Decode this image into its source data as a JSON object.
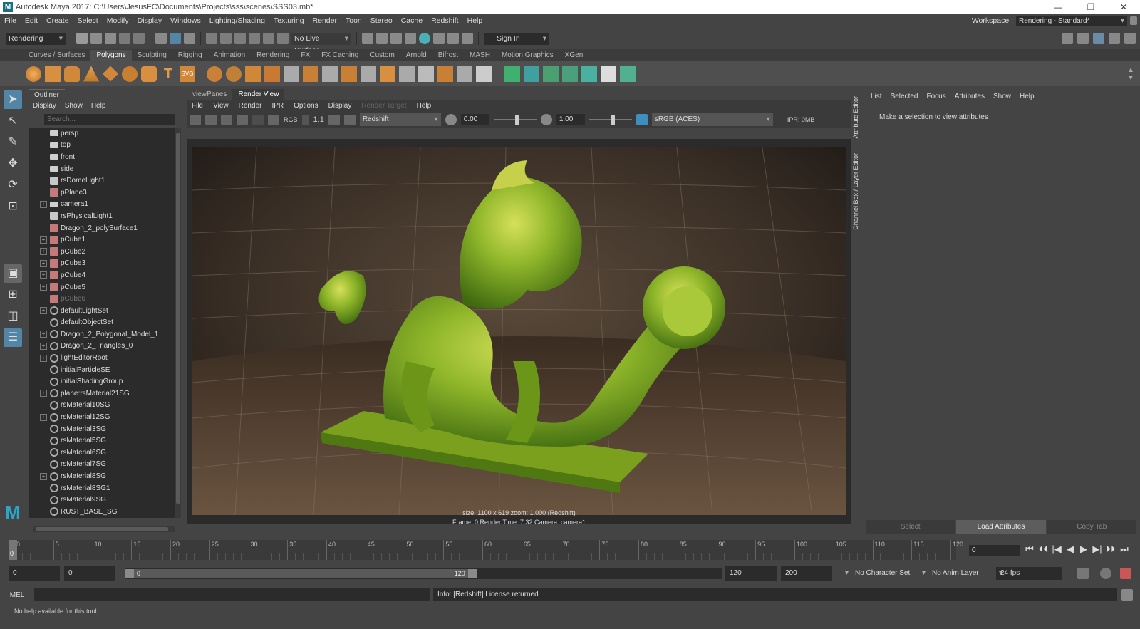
{
  "window": {
    "title": "Autodesk Maya 2017: C:\\Users\\JesusFC\\Documents\\Projects\\sss\\scenes\\SSS03.mb*",
    "app_icon": "M",
    "controls": [
      "—",
      "❐",
      "✕"
    ]
  },
  "menu": {
    "items": [
      "File",
      "Edit",
      "Create",
      "Select",
      "Modify",
      "Display",
      "Windows",
      "Lighting/Shading",
      "Texturing",
      "Render",
      "Toon",
      "Stereo",
      "Cache",
      "Redshift",
      "Help"
    ],
    "workspace_label": "Workspace :",
    "workspace_value": "Rendering - Standard*"
  },
  "statusline": {
    "menuset": "Rendering",
    "live_surface": "No Live Surface",
    "sign_in": "Sign In"
  },
  "shelf": {
    "tabs": [
      "Curves / Surfaces",
      "Polygons",
      "Sculpting",
      "Rigging",
      "Animation",
      "Rendering",
      "FX",
      "FX Caching",
      "Custom",
      "Arnold",
      "Bifrost",
      "MASH",
      "Motion Graphics",
      "XGen"
    ],
    "active_tab": "Polygons",
    "svg_label": "SVG",
    "text_label": "T"
  },
  "outliner": {
    "tab": "Outliner",
    "menu": [
      "Display",
      "Show",
      "Help"
    ],
    "search_placeholder": "Search...",
    "items": [
      {
        "name": "persp",
        "icon": "camera-icon",
        "expand": false,
        "dim": false
      },
      {
        "name": "top",
        "icon": "camera-icon",
        "expand": false,
        "dim": false
      },
      {
        "name": "front",
        "icon": "camera-icon",
        "expand": false,
        "dim": false
      },
      {
        "name": "side",
        "icon": "camera-icon",
        "expand": false,
        "dim": false
      },
      {
        "name": "rsDomeLight1",
        "icon": "light-icon",
        "expand": false,
        "dim": false
      },
      {
        "name": "pPlane3",
        "icon": "mesh-icon",
        "expand": false,
        "dim": false
      },
      {
        "name": "camera1",
        "icon": "camera-icon",
        "expand": true,
        "dim": false
      },
      {
        "name": "rsPhysicalLight1",
        "icon": "light-icon",
        "expand": false,
        "dim": false
      },
      {
        "name": "Dragon_2_polySurface1",
        "icon": "mesh-icon",
        "expand": false,
        "dim": false
      },
      {
        "name": "pCube1",
        "icon": "mesh-icon",
        "expand": true,
        "dim": false
      },
      {
        "name": "pCube2",
        "icon": "mesh-icon",
        "expand": true,
        "dim": false
      },
      {
        "name": "pCube3",
        "icon": "mesh-icon",
        "expand": true,
        "dim": false
      },
      {
        "name": "pCube4",
        "icon": "mesh-icon",
        "expand": true,
        "dim": false
      },
      {
        "name": "pCube5",
        "icon": "mesh-icon",
        "expand": true,
        "dim": false
      },
      {
        "name": "pCube6",
        "icon": "mesh-icon",
        "expand": false,
        "dim": true
      },
      {
        "name": "defaultLightSet",
        "icon": "set-icon",
        "expand": true,
        "dim": false
      },
      {
        "name": "defaultObjectSet",
        "icon": "set-icon",
        "expand": false,
        "dim": false
      },
      {
        "name": "Dragon_2_Polygonal_Model_1",
        "icon": "set-icon",
        "expand": true,
        "dim": false
      },
      {
        "name": "Dragon_2_Triangles_0",
        "icon": "set-icon",
        "expand": true,
        "dim": false
      },
      {
        "name": "lightEditorRoot",
        "icon": "set-icon",
        "expand": true,
        "dim": false
      },
      {
        "name": "initialParticleSE",
        "icon": "set-icon",
        "expand": false,
        "dim": false
      },
      {
        "name": "initialShadingGroup",
        "icon": "set-icon",
        "expand": false,
        "dim": false
      },
      {
        "name": "plane:rsMaterial21SG",
        "icon": "set-icon",
        "expand": true,
        "dim": false
      },
      {
        "name": "rsMaterial10SG",
        "icon": "set-icon",
        "expand": false,
        "dim": false
      },
      {
        "name": "rsMaterial12SG",
        "icon": "set-icon",
        "expand": true,
        "dim": false
      },
      {
        "name": "rsMaterial3SG",
        "icon": "set-icon",
        "expand": false,
        "dim": false
      },
      {
        "name": "rsMaterial5SG",
        "icon": "set-icon",
        "expand": false,
        "dim": false
      },
      {
        "name": "rsMaterial6SG",
        "icon": "set-icon",
        "expand": false,
        "dim": false
      },
      {
        "name": "rsMaterial7SG",
        "icon": "set-icon",
        "expand": false,
        "dim": false
      },
      {
        "name": "rsMaterial8SG",
        "icon": "set-icon",
        "expand": true,
        "dim": false
      },
      {
        "name": "rsMaterial8SG1",
        "icon": "set-icon",
        "expand": false,
        "dim": false
      },
      {
        "name": "rsMaterial9SG",
        "icon": "set-icon",
        "expand": false,
        "dim": false
      },
      {
        "name": "RUST_BASE_SG",
        "icon": "set-icon",
        "expand": false,
        "dim": false
      }
    ]
  },
  "renderview": {
    "tabs": [
      "viewPanes",
      "Render View"
    ],
    "active_tab": "Render View",
    "menu": [
      "File",
      "View",
      "Render",
      "IPR",
      "Options",
      "Display",
      "Render Target",
      "Help"
    ],
    "disabled_menu": "Render Target",
    "rgb_label": "RGB",
    "ratio_label": "1:1",
    "renderer": "Redshift",
    "exposure": "0.00",
    "gamma": "1.00",
    "colorspace": "sRGB (ACES)",
    "ipr": "IPR: 0MB",
    "info_line1": "size: 1100 x 619  zoom: 1.000       (Redshift)",
    "info_line2": "Frame: 0       Render Time: 7:32       Camera: camera1"
  },
  "attribute_editor": {
    "menu": [
      "List",
      "Selected",
      "Focus",
      "Attributes",
      "Show",
      "Help"
    ],
    "message": "Make a selection to view attributes",
    "side_tabs": [
      "Attribute Editor",
      "Channel Box / Layer Editor"
    ],
    "buttons": [
      "Select",
      "Load Attributes",
      "Copy Tab"
    ],
    "active_button": "Load Attributes"
  },
  "timeline": {
    "start": 0,
    "end": 120,
    "major_ticks": [
      0,
      5,
      10,
      15,
      20,
      25,
      30,
      35,
      40,
      45,
      50,
      55,
      60,
      65,
      70,
      75,
      80,
      85,
      90,
      95,
      100,
      105,
      110,
      115,
      120
    ],
    "current_frame": "0",
    "current_field": "0",
    "playback": [
      "⏮",
      "⏴⏴",
      "|◀",
      "◀",
      "▶",
      "▶|",
      "⏵⏵",
      "⏭"
    ]
  },
  "range": {
    "start_field": "0",
    "start2_field": "0",
    "range_start": "0",
    "range_end": "120",
    "end_field": "120",
    "end2_field": "200",
    "character_set": "No Character Set",
    "anim_layer": "No Anim Layer",
    "fps": "24 fps"
  },
  "command": {
    "label": "MEL",
    "result": "Info:  [Redshift] License returned",
    "help": "No help available for this tool"
  },
  "colors": {
    "accent": "#5285a6",
    "panel": "#444444",
    "field": "#2b2b2b",
    "dragon": "#8fb62a"
  }
}
